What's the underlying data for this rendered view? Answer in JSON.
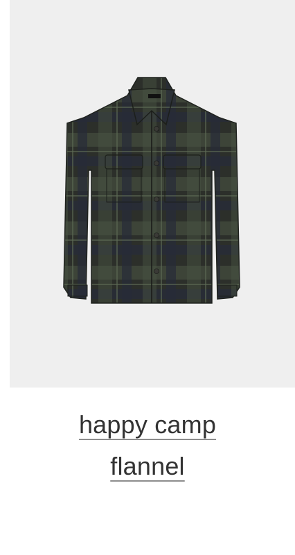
{
  "product": {
    "image_alt": "dark green plaid flannel shirt jacket",
    "title_lines": [
      "happy camp",
      "flannel"
    ]
  },
  "colors": {
    "image_background": "#efefef",
    "fabric_base": "#2c2f2a",
    "plaid_green": "#4a5543",
    "plaid_navy": "#272b38",
    "title_text": "#333333",
    "underline": "#8d8d8d"
  }
}
